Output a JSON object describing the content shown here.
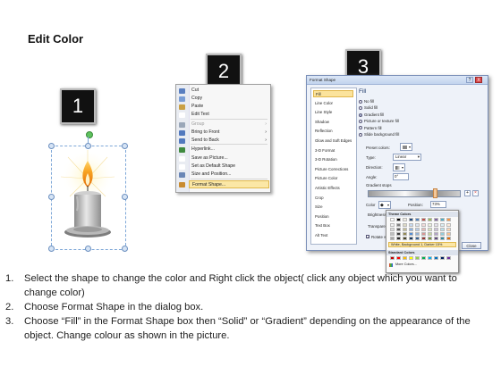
{
  "header": {
    "title": "Edit Color"
  },
  "steps": [
    "1",
    "2",
    "3"
  ],
  "context_menu": {
    "items": [
      {
        "label": "Cut",
        "underline": "t",
        "icon": "scissors-icon",
        "color": "#5a7fc0"
      },
      {
        "label": "Copy",
        "underline": "C",
        "icon": "copy-icon",
        "color": "#7a9ed6"
      },
      {
        "label": "Paste",
        "underline": "P",
        "icon": "paste-icon",
        "color": "#c9a045"
      },
      {
        "label": "Edit Text",
        "underline": "x",
        "icon": "edit-text-icon",
        "color": "#ffffff"
      },
      {
        "label": "Group",
        "underline": "G",
        "icon": "group-icon",
        "color": "#9aa7b9",
        "disabled": true,
        "submenu": true
      },
      {
        "label": "Bring to Front",
        "underline": "R",
        "icon": "bring-front-icon",
        "color": "#5279be",
        "submenu": true
      },
      {
        "label": "Send to Back",
        "underline": "K",
        "icon": "send-back-icon",
        "color": "#5279be",
        "submenu": true
      },
      {
        "label": "Hyperlink...",
        "underline": "H",
        "icon": "hyperlink-icon",
        "color": "#3f8a3f"
      },
      {
        "label": "Save as Picture...",
        "underline": "S",
        "icon": "",
        "color": "#ffffff"
      },
      {
        "label": "Set as Default Shape",
        "underline": "D",
        "icon": "",
        "color": "#ffffff"
      },
      {
        "label": "Size and Position...",
        "underline": "z",
        "icon": "size-position-icon",
        "color": "#6a86b6"
      },
      {
        "label": "Format Shape...",
        "underline": "o",
        "icon": "format-shape-icon",
        "color": "#c98b2f",
        "highlighted": true
      }
    ]
  },
  "dialog": {
    "title": "Format Shape",
    "help": "?",
    "close": "X",
    "nav": [
      "Fill",
      "Line Color",
      "Line Style",
      "Shadow",
      "Reflection",
      "Glow and Soft Edges",
      "3-D Format",
      "3-D Rotation",
      "Picture Corrections",
      "Picture Color",
      "Artistic Effects",
      "Crop",
      "Size",
      "Position",
      "Text Box",
      "Alt Text"
    ],
    "nav_selected": "Fill",
    "pane_title": "Fill",
    "fill_options": [
      "No fill",
      "Solid fill",
      "Gradient fill",
      "Picture or texture fill",
      "Pattern fill",
      "Slide background fill"
    ],
    "fill_selected": "Gradient fill",
    "preset_colors_label": "Preset colors:",
    "type_label": "Type:",
    "type_value": "Linear",
    "direction_label": "Direction:",
    "angle_label": "Angle:",
    "angle_value": "0°",
    "gradient_stops_label": "Gradient stops",
    "color_label": "Color",
    "position_label": "Position:",
    "position_value": "73%",
    "brightness_label": "Brightness",
    "transparency_label": "Transparency",
    "rotate_label": "Rotate with shape",
    "close_button": "Close"
  },
  "palette": {
    "theme_header": "Theme Colors",
    "highlight_text": "White, Background 1, Darker 15%",
    "standard_header": "Standard Colors",
    "more_colors": "More Colors...",
    "theme_top": [
      "#ffffff",
      "#000000",
      "#eeece1",
      "#1f497d",
      "#4f81bd",
      "#c0504d",
      "#9bbb59",
      "#8064a2",
      "#4bacc6",
      "#f79646"
    ],
    "theme_shades": [
      [
        "#f2f2f2",
        "#7f7f7f",
        "#ddd9c3",
        "#c6d9f0",
        "#dbe5f1",
        "#f2dcdb",
        "#ebf1dd",
        "#e5e0ec",
        "#dbeef3",
        "#fdeada"
      ],
      [
        "#d8d8d8",
        "#595959",
        "#c4bd97",
        "#8db3e2",
        "#b8cce4",
        "#e5b9b7",
        "#d7e3bc",
        "#ccc1d9",
        "#b7dde8",
        "#fbd5b5"
      ],
      [
        "#bfbfbf",
        "#3f3f3f",
        "#938953",
        "#548dd4",
        "#95b3d7",
        "#d99694",
        "#c3d69b",
        "#b2a2c7",
        "#92cddc",
        "#fac08f"
      ],
      [
        "#a5a5a5",
        "#262626",
        "#494429",
        "#17365d",
        "#366092",
        "#953734",
        "#76923c",
        "#5f497a",
        "#31859b",
        "#e36c09"
      ]
    ],
    "standard": [
      "#c00000",
      "#ff0000",
      "#ffc000",
      "#ffff00",
      "#92d050",
      "#00b050",
      "#00b0f0",
      "#0070c0",
      "#002060",
      "#7030a0"
    ]
  },
  "instructions": [
    {
      "num": "1.",
      "text": "Select the shape to change the color and Right click the object( click any object which you want to change color)"
    },
    {
      "num": "2.",
      "text": "Choose Format Shape in the dialog box."
    },
    {
      "num": "3.",
      "text": "Choose “Fill” in the Format Shape box then “Solid” or “Gradient” depending on the appearance of the object. Change colour as shown in the picture."
    }
  ]
}
